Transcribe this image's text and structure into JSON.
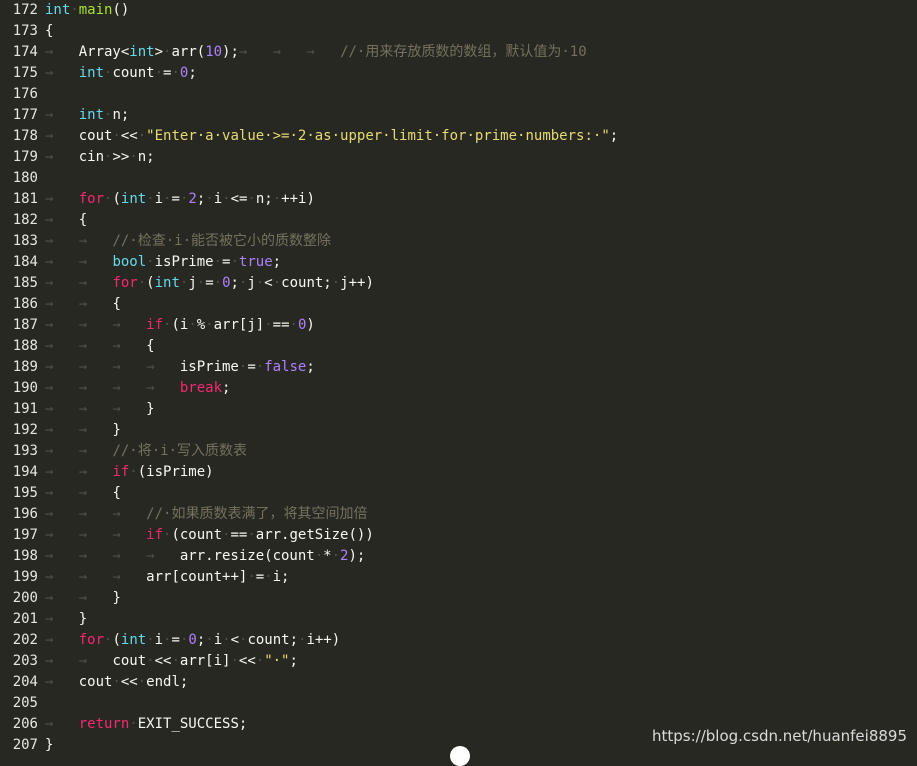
{
  "editor": {
    "lines": [
      {
        "n": "172",
        "tokens": [
          [
            "type",
            "int"
          ],
          [
            "ws",
            "·"
          ],
          [
            "fn",
            "main"
          ],
          [
            "plain",
            "()"
          ]
        ]
      },
      {
        "n": "173",
        "tokens": [
          [
            "plain",
            "{"
          ]
        ]
      },
      {
        "n": "174",
        "tokens": [
          [
            "ws",
            "→   "
          ],
          [
            "plain",
            "Array<"
          ],
          [
            "type",
            "int"
          ],
          [
            "plain",
            ">"
          ],
          [
            "ws",
            "·"
          ],
          [
            "plain",
            "arr("
          ],
          [
            "num",
            "10"
          ],
          [
            "plain",
            ");"
          ],
          [
            "ws",
            "→   →   →   "
          ],
          [
            "cmt",
            "//·用来存放质数的数组，默认值为·10"
          ]
        ]
      },
      {
        "n": "175",
        "tokens": [
          [
            "ws",
            "→   "
          ],
          [
            "type",
            "int"
          ],
          [
            "ws",
            "·"
          ],
          [
            "plain",
            "count"
          ],
          [
            "ws",
            "·"
          ],
          [
            "plain",
            "="
          ],
          [
            "ws",
            "·"
          ],
          [
            "num",
            "0"
          ],
          [
            "plain",
            ";"
          ]
        ]
      },
      {
        "n": "176",
        "tokens": []
      },
      {
        "n": "177",
        "tokens": [
          [
            "ws",
            "→   "
          ],
          [
            "type",
            "int"
          ],
          [
            "ws",
            "·"
          ],
          [
            "plain",
            "n;"
          ]
        ]
      },
      {
        "n": "178",
        "tokens": [
          [
            "ws",
            "→   "
          ],
          [
            "plain",
            "cout"
          ],
          [
            "ws",
            "·"
          ],
          [
            "plain",
            "<<"
          ],
          [
            "ws",
            "·"
          ],
          [
            "str",
            "\"Enter·a·value·>=·2·as·upper·limit·for·prime·numbers:·\""
          ],
          [
            "plain",
            ";"
          ]
        ]
      },
      {
        "n": "179",
        "tokens": [
          [
            "ws",
            "→   "
          ],
          [
            "plain",
            "cin"
          ],
          [
            "ws",
            "·"
          ],
          [
            "plain",
            ">>"
          ],
          [
            "ws",
            "·"
          ],
          [
            "plain",
            "n;"
          ]
        ]
      },
      {
        "n": "180",
        "tokens": []
      },
      {
        "n": "181",
        "tokens": [
          [
            "ws",
            "→   "
          ],
          [
            "kw",
            "for"
          ],
          [
            "ws",
            "·"
          ],
          [
            "plain",
            "("
          ],
          [
            "type",
            "int"
          ],
          [
            "ws",
            "·"
          ],
          [
            "plain",
            "i"
          ],
          [
            "ws",
            "·"
          ],
          [
            "plain",
            "="
          ],
          [
            "ws",
            "·"
          ],
          [
            "num",
            "2"
          ],
          [
            "plain",
            ";"
          ],
          [
            "ws",
            "·"
          ],
          [
            "plain",
            "i"
          ],
          [
            "ws",
            "·"
          ],
          [
            "plain",
            "<="
          ],
          [
            "ws",
            "·"
          ],
          [
            "plain",
            "n;"
          ],
          [
            "ws",
            "·"
          ],
          [
            "plain",
            "++i)"
          ]
        ]
      },
      {
        "n": "182",
        "tokens": [
          [
            "ws",
            "→   "
          ],
          [
            "plain",
            "{"
          ]
        ]
      },
      {
        "n": "183",
        "tokens": [
          [
            "ws",
            "→   →   "
          ],
          [
            "cmt",
            "//·检查·i·能否被它小的质数整除"
          ]
        ]
      },
      {
        "n": "184",
        "tokens": [
          [
            "ws",
            "→   →   "
          ],
          [
            "type",
            "bool"
          ],
          [
            "ws",
            "·"
          ],
          [
            "plain",
            "isPrime"
          ],
          [
            "ws",
            "·"
          ],
          [
            "plain",
            "="
          ],
          [
            "ws",
            "·"
          ],
          [
            "bool",
            "true"
          ],
          [
            "plain",
            ";"
          ]
        ]
      },
      {
        "n": "185",
        "tokens": [
          [
            "ws",
            "→   →   "
          ],
          [
            "kw",
            "for"
          ],
          [
            "ws",
            "·"
          ],
          [
            "plain",
            "("
          ],
          [
            "type",
            "int"
          ],
          [
            "ws",
            "·"
          ],
          [
            "plain",
            "j"
          ],
          [
            "ws",
            "·"
          ],
          [
            "plain",
            "="
          ],
          [
            "ws",
            "·"
          ],
          [
            "num",
            "0"
          ],
          [
            "plain",
            ";"
          ],
          [
            "ws",
            "·"
          ],
          [
            "plain",
            "j"
          ],
          [
            "ws",
            "·"
          ],
          [
            "plain",
            "<"
          ],
          [
            "ws",
            "·"
          ],
          [
            "plain",
            "count;"
          ],
          [
            "ws",
            "·"
          ],
          [
            "plain",
            "j++)"
          ]
        ]
      },
      {
        "n": "186",
        "tokens": [
          [
            "ws",
            "→   →   "
          ],
          [
            "plain",
            "{"
          ]
        ]
      },
      {
        "n": "187",
        "tokens": [
          [
            "ws",
            "→   →   →   "
          ],
          [
            "kw",
            "if"
          ],
          [
            "ws",
            "·"
          ],
          [
            "plain",
            "(i"
          ],
          [
            "ws",
            "·"
          ],
          [
            "plain",
            "%"
          ],
          [
            "ws",
            "·"
          ],
          [
            "plain",
            "arr[j]"
          ],
          [
            "ws",
            "·"
          ],
          [
            "plain",
            "=="
          ],
          [
            "ws",
            "·"
          ],
          [
            "num",
            "0"
          ],
          [
            "plain",
            ")"
          ]
        ]
      },
      {
        "n": "188",
        "tokens": [
          [
            "ws",
            "→   →   →   "
          ],
          [
            "plain",
            "{"
          ]
        ]
      },
      {
        "n": "189",
        "tokens": [
          [
            "ws",
            "→   →   →   →   "
          ],
          [
            "plain",
            "isPrime"
          ],
          [
            "ws",
            "·"
          ],
          [
            "plain",
            "="
          ],
          [
            "ws",
            "·"
          ],
          [
            "bool",
            "false"
          ],
          [
            "plain",
            ";"
          ]
        ]
      },
      {
        "n": "190",
        "tokens": [
          [
            "ws",
            "→   →   →   →   "
          ],
          [
            "kw",
            "break"
          ],
          [
            "plain",
            ";"
          ]
        ]
      },
      {
        "n": "191",
        "tokens": [
          [
            "ws",
            "→   →   →   "
          ],
          [
            "plain",
            "}"
          ]
        ]
      },
      {
        "n": "192",
        "tokens": [
          [
            "ws",
            "→   →   "
          ],
          [
            "plain",
            "}"
          ]
        ]
      },
      {
        "n": "193",
        "tokens": [
          [
            "ws",
            "→   →   "
          ],
          [
            "cmt",
            "//·将·i·写入质数表"
          ]
        ]
      },
      {
        "n": "194",
        "tokens": [
          [
            "ws",
            "→   →   "
          ],
          [
            "kw",
            "if"
          ],
          [
            "ws",
            "·"
          ],
          [
            "plain",
            "(isPrime)"
          ]
        ]
      },
      {
        "n": "195",
        "tokens": [
          [
            "ws",
            "→   →   "
          ],
          [
            "plain",
            "{"
          ]
        ]
      },
      {
        "n": "196",
        "tokens": [
          [
            "ws",
            "→   →   →   "
          ],
          [
            "cmt",
            "//·如果质数表满了，将其空间加倍"
          ]
        ]
      },
      {
        "n": "197",
        "tokens": [
          [
            "ws",
            "→   →   →   "
          ],
          [
            "kw",
            "if"
          ],
          [
            "ws",
            "·"
          ],
          [
            "plain",
            "(count"
          ],
          [
            "ws",
            "·"
          ],
          [
            "plain",
            "=="
          ],
          [
            "ws",
            "·"
          ],
          [
            "plain",
            "arr.getSize())"
          ]
        ]
      },
      {
        "n": "198",
        "tokens": [
          [
            "ws",
            "→   →   →   →   "
          ],
          [
            "plain",
            "arr.resize(count"
          ],
          [
            "ws",
            "·"
          ],
          [
            "plain",
            "*"
          ],
          [
            "ws",
            "·"
          ],
          [
            "num",
            "2"
          ],
          [
            "plain",
            ");"
          ]
        ]
      },
      {
        "n": "199",
        "tokens": [
          [
            "ws",
            "→   →   →   "
          ],
          [
            "plain",
            "arr[count++]"
          ],
          [
            "ws",
            "·"
          ],
          [
            "plain",
            "="
          ],
          [
            "ws",
            "·"
          ],
          [
            "plain",
            "i;"
          ]
        ]
      },
      {
        "n": "200",
        "tokens": [
          [
            "ws",
            "→   →   "
          ],
          [
            "plain",
            "}"
          ]
        ]
      },
      {
        "n": "201",
        "tokens": [
          [
            "ws",
            "→   "
          ],
          [
            "plain",
            "}"
          ]
        ]
      },
      {
        "n": "202",
        "tokens": [
          [
            "ws",
            "→   "
          ],
          [
            "kw",
            "for"
          ],
          [
            "ws",
            "·"
          ],
          [
            "plain",
            "("
          ],
          [
            "type",
            "int"
          ],
          [
            "ws",
            "·"
          ],
          [
            "plain",
            "i"
          ],
          [
            "ws",
            "·"
          ],
          [
            "plain",
            "="
          ],
          [
            "ws",
            "·"
          ],
          [
            "num",
            "0"
          ],
          [
            "plain",
            ";"
          ],
          [
            "ws",
            "·"
          ],
          [
            "plain",
            "i"
          ],
          [
            "ws",
            "·"
          ],
          [
            "plain",
            "<"
          ],
          [
            "ws",
            "·"
          ],
          [
            "plain",
            "count;"
          ],
          [
            "ws",
            "·"
          ],
          [
            "plain",
            "i++)"
          ]
        ]
      },
      {
        "n": "203",
        "tokens": [
          [
            "ws",
            "→   →   "
          ],
          [
            "plain",
            "cout"
          ],
          [
            "ws",
            "·"
          ],
          [
            "plain",
            "<<"
          ],
          [
            "ws",
            "·"
          ],
          [
            "plain",
            "arr[i]"
          ],
          [
            "ws",
            "·"
          ],
          [
            "plain",
            "<<"
          ],
          [
            "ws",
            "·"
          ],
          [
            "str",
            "\"·\""
          ],
          [
            "plain",
            ";"
          ]
        ]
      },
      {
        "n": "204",
        "tokens": [
          [
            "ws",
            "→   "
          ],
          [
            "plain",
            "cout"
          ],
          [
            "ws",
            "·"
          ],
          [
            "plain",
            "<<"
          ],
          [
            "ws",
            "·"
          ],
          [
            "plain",
            "endl;"
          ]
        ]
      },
      {
        "n": "205",
        "tokens": []
      },
      {
        "n": "206",
        "tokens": [
          [
            "ws",
            "→   "
          ],
          [
            "kw",
            "return"
          ],
          [
            "ws",
            "·"
          ],
          [
            "plain",
            "EXIT_SUCCESS;"
          ]
        ]
      },
      {
        "n": "207",
        "tokens": [
          [
            "plain",
            "}"
          ]
        ]
      }
    ]
  },
  "watermark": "https://blog.csdn.net/huanfei8895",
  "colors": {
    "background": "#272822",
    "keyword": "#f92672",
    "type": "#66d9ef",
    "function": "#a6e22e",
    "number": "#ae81ff",
    "string": "#e6db74",
    "comment": "#75715e",
    "text": "#f8f8f2"
  }
}
